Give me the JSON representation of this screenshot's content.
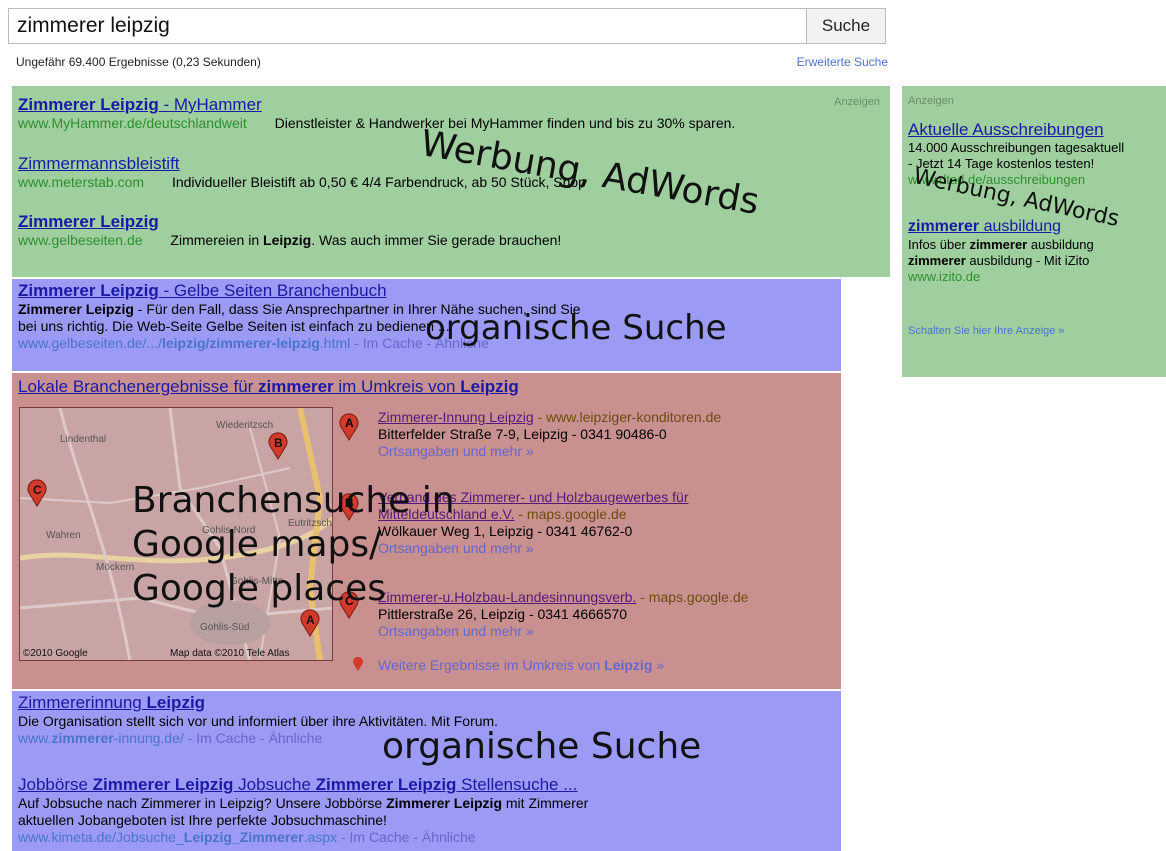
{
  "search": {
    "query": "zimmerer leipzig",
    "button": "Suche"
  },
  "stats": "Ungefähr 69.400 Ergebnisse (0,23 Sekunden)",
  "advanced_search": "Erweiterte Suche",
  "ads_top": {
    "label": "Anzeigen",
    "items": [
      {
        "title_bold": "Zimmerer Leipzig",
        "title_rest": " - MyHammer",
        "url": "www.MyHammer.de/deutschlandweit",
        "desc": "Dienstleister & Handwerker bei MyHammer finden und bis zu 30% sparen."
      },
      {
        "title_bold": "",
        "title_rest": "Zimmermannsbleistift",
        "url": "www.meterstab.com",
        "desc": "Individueller Bleistift ab 0,50 € 4/4 Farbendruck, ab 50 Stück, Shop"
      },
      {
        "title_bold": "Zimmerer Leipzig",
        "title_rest": "",
        "url": "www.gelbeseiten.de",
        "desc_pre": "Zimmereien in ",
        "desc_bold": "Leipzig",
        "desc_post": ". Was auch immer Sie gerade brauchen!"
      }
    ],
    "overlay": "Werbung, AdWords"
  },
  "ads_side": {
    "label": "Anzeigen",
    "items": [
      {
        "title": "Aktuelle Ausschreibungen",
        "line1": "14.000 Ausschreibungen tagesaktuell",
        "line2": "- Jetzt 14 Tage kostenlos testen!",
        "url": "www.dtad.de/ausschreibungen"
      },
      {
        "title_bold": "zimmerer",
        "title_rest": " ausbildung",
        "line1_pre": "Infos über ",
        "line1_bold": "zimmerer",
        "line1_post": " ausbildung",
        "line2_bold": "zimmerer",
        "line2_post": " ausbildung - Mit iZito",
        "url": "www.izito.de"
      }
    ],
    "footer": "Schalten Sie hier Ihre Anzeige »",
    "overlay": "Werbung, AdWords"
  },
  "organic_1": {
    "title_bold": "Zimmerer Leipzig",
    "title_rest": " - Gelbe Seiten Branchenbuch",
    "snippet_bold": "Zimmerer Leipzig",
    "snippet1": " - Für den Fall, dass Sie Ansprechpartner in Ihrer Nähe suchen, sind Sie",
    "snippet2": "bei uns richtig. Die Web-Seite Gelbe Seiten ist einfach zu bedienen ...",
    "url_pre": "www.gelbeseiten.de/.../",
    "url_bold": "leipzig/zimmerer-leipzig",
    "url_post": ".html",
    "cache": " - Im Cache - Ähnliche",
    "overlay": "organische Suche"
  },
  "local": {
    "header_pre": "Lokale Branchenergebnisse für ",
    "header_b1": "zimmerer",
    "header_mid": " im Umkreis von ",
    "header_b2": "Leipzig",
    "map": {
      "labels": [
        "Lindenthal",
        "Wiederitzsch",
        "Wahren",
        "Gohlis-Nord",
        "Eutritzsch",
        "Möckern",
        "Gohlis-Mitte",
        "Gohlis-Süd"
      ],
      "copyright": "©2010 Google",
      "mapdata": "Map data ©2010 Tele Atlas",
      "pins": [
        "A",
        "B",
        "C"
      ]
    },
    "listings": [
      {
        "pin": "A",
        "title": "Zimmerer-Innung Leipzig",
        "src": " - www.leipziger-konditoren.de",
        "addr": "Bitterfelder Straße 7-9, Leipzig - 0341 90486-0",
        "more": "Ortsangaben und mehr »"
      },
      {
        "pin": "B",
        "title": "Verband des Zimmerer- und Holzbaugewerbes für",
        "title2": "Mitteldeutschland e.V.",
        "src": " - maps.google.de",
        "addr": "Wölkauer Weg 1, Leipzig - 0341 46762-0",
        "more": "Ortsangaben und mehr »"
      },
      {
        "pin": "C",
        "title": "Zimmerer-u.Holzbau-Landesinnungsverb.",
        "src": " - maps.google.de",
        "addr": "Pittlerstraße 26, Leipzig - 0341 4666570",
        "more": "Ortsangaben und mehr »"
      }
    ],
    "more_results_pre": "Weitere Ergebnisse im Umkreis von ",
    "more_results_bold": "Leipzig",
    "more_results_post": " »",
    "overlay_lines": [
      "Branchensuche in",
      "Google maps/",
      "Google places"
    ]
  },
  "organic_2": {
    "items": [
      {
        "title_pre": "Zimmererinnung ",
        "title_bold": "Leipzig",
        "snippet": "Die Organisation stellt sich vor und informiert über ihre Aktivitäten. Mit Forum.",
        "url_pre": "www.",
        "url_bold": "zimmerer",
        "url_post": "-innung.de/",
        "cache": " - Im Cache - Ähnliche"
      },
      {
        "title_pre": "Jobbörse ",
        "title_bold": "Zimmerer Leipzig",
        "title_mid": " Jobsuche ",
        "title_bold2": "Zimmerer Leipzig",
        "title_post": " Stellensuche ...",
        "snippet_pre": "Auf Jobsuche nach Zimmerer in Leipzig? Unsere Jobbörse ",
        "snippet_bold": "Zimmerer Leipzig",
        "snippet_post": " mit Zimmerer",
        "snippet2": "aktuellen Jobangeboten ist Ihre perfekte Jobsuchmaschine!",
        "url_pre": "www.kimeta.de/Jobsuche_",
        "url_bold": "Leipzig_Zimmerer",
        "url_post": ".aspx",
        "cache": " - Im Cache - Ähnliche"
      }
    ],
    "overlay": "organische Suche"
  }
}
